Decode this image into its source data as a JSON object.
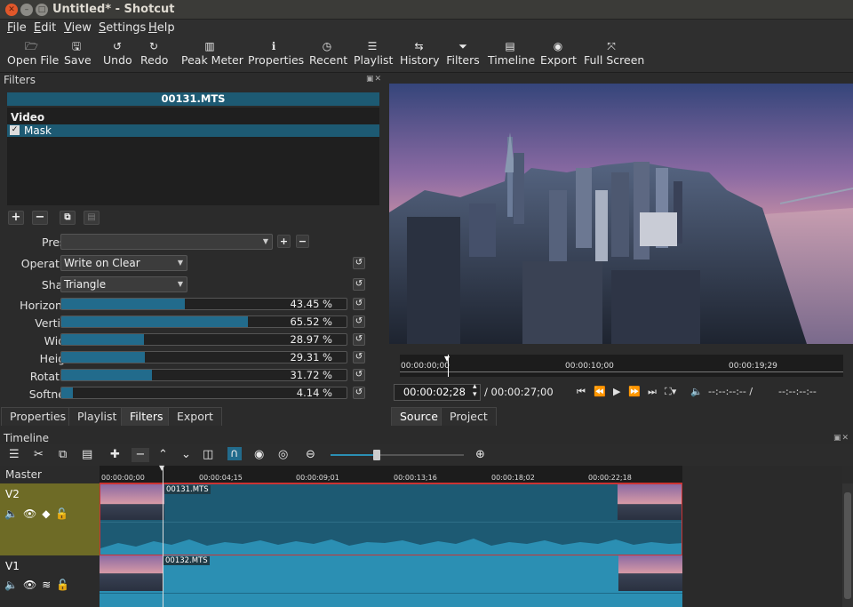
{
  "window": {
    "title": "Untitled* - Shotcut"
  },
  "menu": [
    "File",
    "Edit",
    "View",
    "Settings",
    "Help"
  ],
  "toolbar": [
    {
      "icon": "open-folder-icon",
      "glyph": "🗁",
      "label": "Open File"
    },
    {
      "icon": "save-icon",
      "glyph": "🖫",
      "label": "Save"
    },
    {
      "icon": "undo-icon",
      "glyph": "↺",
      "label": "Undo"
    },
    {
      "icon": "redo-icon",
      "glyph": "↻",
      "label": "Redo"
    },
    {
      "icon": "peak-meter-icon",
      "glyph": "▥",
      "label": "Peak Meter"
    },
    {
      "icon": "info-icon",
      "glyph": "ℹ",
      "label": "Properties"
    },
    {
      "icon": "clock-icon",
      "glyph": "◷",
      "label": "Recent"
    },
    {
      "icon": "list-icon",
      "glyph": "☰",
      "label": "Playlist"
    },
    {
      "icon": "history-icon",
      "glyph": "⇆",
      "label": "History"
    },
    {
      "icon": "funnel-icon",
      "glyph": "⏷",
      "label": "Filters"
    },
    {
      "icon": "timeline-icon",
      "glyph": "▤",
      "label": "Timeline"
    },
    {
      "icon": "export-icon",
      "glyph": "◉",
      "label": "Export"
    },
    {
      "icon": "fullscreen-icon",
      "glyph": "⤧",
      "label": "Full Screen"
    }
  ],
  "filters": {
    "panel_title": "Filters",
    "clip_name": "00131.MTS",
    "category": "Video",
    "filter_name": "Mask",
    "preset_label": "Preset",
    "preset_value": "",
    "operation_label": "Operation",
    "operation_value": "Write on Clear",
    "shape_label": "Shape",
    "shape_value": "Triangle",
    "params": [
      {
        "label": "Horizontal",
        "value": "43.45 %",
        "fraction": 0.4345
      },
      {
        "label": "Vertical",
        "value": "65.52 %",
        "fraction": 0.6552
      },
      {
        "label": "Width",
        "value": "28.97 %",
        "fraction": 0.2897
      },
      {
        "label": "Height",
        "value": "29.31 %",
        "fraction": 0.2931
      },
      {
        "label": "Rotation",
        "value": "31.72 %",
        "fraction": 0.3172
      },
      {
        "label": "Softness",
        "value": "4.14 %",
        "fraction": 0.0414
      }
    ]
  },
  "left_tabs": [
    "Properties",
    "Playlist",
    "Filters",
    "Export"
  ],
  "left_tabs_active": "Filters",
  "player": {
    "ruler_ticks": [
      "00:00:00;00",
      "00:00:10;00",
      "00:00:19;29"
    ],
    "position": "00:00:02;28",
    "duration": "/ 00:00:27;00",
    "in_point": "--:--:--:-- /",
    "out_point": "--:--:--:--",
    "tabs": [
      "Source",
      "Project"
    ],
    "tabs_active": "Source"
  },
  "timeline": {
    "title": "Timeline",
    "master_label": "Master",
    "ruler_ticks": [
      "00:00:00;00",
      "00:00:04;15",
      "00:00:09;01",
      "00:00:13;16",
      "00:00:18;02",
      "00:00:22;18"
    ],
    "tracks": [
      {
        "name": "V2",
        "clip": "00131.MTS"
      },
      {
        "name": "V1",
        "clip": "00132.MTS"
      }
    ]
  },
  "colors": {
    "accent": "#1d5a73",
    "v2_header": "#6e6b26",
    "audio_wave": "#2b8fb3"
  }
}
